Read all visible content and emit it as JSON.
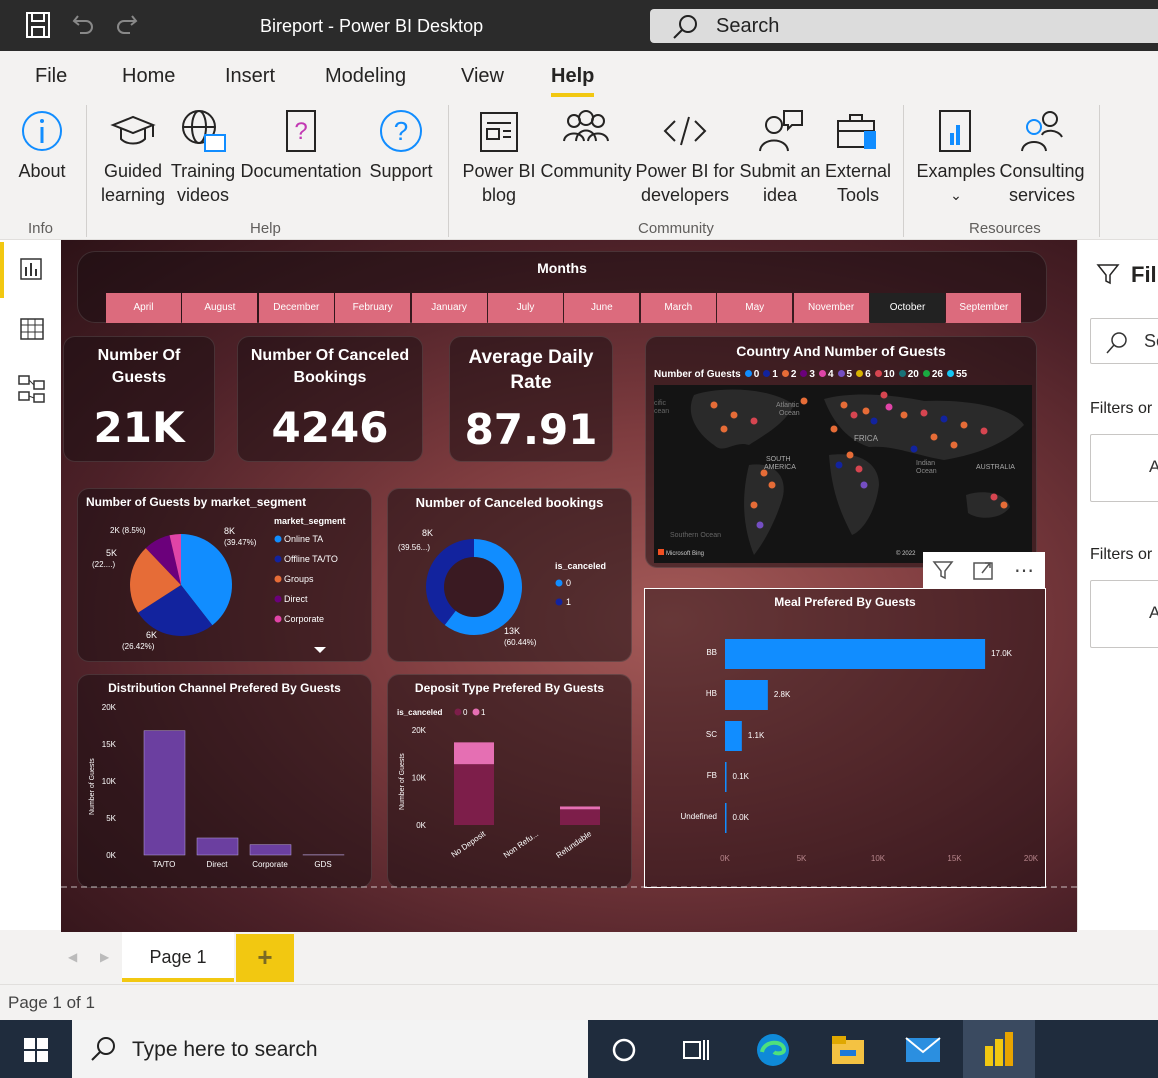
{
  "window": {
    "title": "Bireport - Power BI Desktop",
    "search_label": "Search"
  },
  "menu": [
    "File",
    "Home",
    "Insert",
    "Modeling",
    "View",
    "Help"
  ],
  "ribbon": {
    "buttons": {
      "about": "About",
      "guided": [
        "Guided",
        "learning"
      ],
      "training": [
        "Training",
        "videos"
      ],
      "documentation": "Documentation",
      "support": "Support",
      "blog": [
        "Power BI",
        "blog"
      ],
      "community": "Community",
      "developers": [
        "Power BI for",
        "developers"
      ],
      "submit": [
        "Submit an",
        "idea"
      ],
      "external": [
        "External",
        "Tools"
      ],
      "examples": "Examples",
      "consulting": [
        "Consulting",
        "services"
      ]
    },
    "groups": {
      "info": "Info",
      "help": "Help",
      "community": "Community",
      "resources": "Resources"
    }
  },
  "slicer": {
    "title": "Months",
    "items": [
      "April",
      "August",
      "December",
      "February",
      "January",
      "July",
      "June",
      "March",
      "May",
      "November",
      "October",
      "September"
    ],
    "selected": "October"
  },
  "kpis": [
    {
      "title": [
        "Number Of",
        "Guests"
      ],
      "value": "21K"
    },
    {
      "title": [
        "Number Of Canceled",
        "Bookings"
      ],
      "value": "4246"
    },
    {
      "title": [
        "Average Daily",
        "Rate"
      ],
      "value": "87.91"
    }
  ],
  "map": {
    "title": "Country And Number of Guests",
    "legend_label": "Number of Guests",
    "legend_items": [
      {
        "label": "0",
        "color": "#118dff"
      },
      {
        "label": "1",
        "color": "#12239e"
      },
      {
        "label": "2",
        "color": "#e66c37"
      },
      {
        "label": "3",
        "color": "#6b007b"
      },
      {
        "label": "4",
        "color": "#e044a7"
      },
      {
        "label": "5",
        "color": "#744ec2"
      },
      {
        "label": "6",
        "color": "#d9b300"
      },
      {
        "label": "10",
        "color": "#d64550"
      },
      {
        "label": "20",
        "color": "#197278"
      },
      {
        "label": "26",
        "color": "#1aab40"
      },
      {
        "label": "55",
        "color": "#15c6f4"
      }
    ],
    "labels": {
      "atlantic": [
        "Atlantic",
        "Ocean"
      ],
      "africa": "FRICA",
      "south_america": [
        "SOUTH",
        "AMERICA"
      ],
      "indian": [
        "Indian",
        "Ocean"
      ],
      "australia": "AUSTRALIA",
      "southern": "Southern Ocean",
      "pacific": [
        "cific",
        "cean"
      ],
      "bing": "Microsoft Bing",
      "copyright": "© 2022"
    }
  },
  "pie": {
    "title": "Number of Guests by market_segment",
    "legend_title": "market_segment",
    "labels": {
      "top": [
        "8K",
        "(39.47%)"
      ],
      "bottom": [
        "6K",
        "(26.42%)"
      ],
      "left": [
        "5K",
        "(22....)"
      ],
      "topleft": "2K (8.5%)"
    }
  },
  "donut": {
    "title": "Number of Canceled bookings",
    "legend_title": "is_canceled",
    "labels": {
      "left": [
        "8K",
        "(39.56...)"
      ],
      "right": [
        "13K",
        "(60.44%)"
      ]
    }
  },
  "dist": {
    "title": "Distribution Channel Prefered By Guests",
    "ylabel": "Number of Guests"
  },
  "deposit": {
    "title": "Deposit Type Prefered By Guests",
    "ylabel": "Number of Guests",
    "legend_title": "is_canceled"
  },
  "meal": {
    "title": "Meal Prefered By Guests"
  },
  "chart_data": [
    {
      "type": "pie",
      "title": "Number of Guests by market_segment",
      "categories": [
        "Online TA",
        "Offline TA/TO",
        "Groups",
        "Direct",
        "Corporate"
      ],
      "values": [
        39.47,
        26.42,
        22.0,
        8.5,
        3.61
      ],
      "colors": [
        "#118dff",
        "#12239e",
        "#e66c37",
        "#6b007b",
        "#e044a7"
      ]
    },
    {
      "type": "pie",
      "title": "Number of Canceled bookings",
      "categories": [
        "0",
        "1"
      ],
      "values": [
        60.44,
        39.56
      ],
      "colors": [
        "#118dff",
        "#12239e"
      ]
    },
    {
      "type": "bar",
      "title": "Distribution Channel Prefered By Guests",
      "categories": [
        "TA/TO",
        "Direct",
        "Corporate",
        "GDS"
      ],
      "values": [
        16800,
        2300,
        1400,
        30
      ],
      "ylabel": "Number of Guests",
      "ylim": [
        0,
        20000
      ],
      "yticks": [
        "0K",
        "5K",
        "10K",
        "15K",
        "20K"
      ],
      "color": "#6b3fa0"
    },
    {
      "type": "bar",
      "title": "Deposit Type Prefered By Guests",
      "categories": [
        "No Deposit",
        "Non Refu...",
        "Refundable"
      ],
      "series": [
        {
          "name": "0",
          "values": [
            12800,
            0,
            3300
          ]
        },
        {
          "name": "1",
          "values": [
            4600,
            0,
            600
          ]
        }
      ],
      "stacked": true,
      "ylabel": "Number of Guests",
      "ylim": [
        0,
        20000
      ],
      "yticks": [
        "0K",
        "10K",
        "20K"
      ],
      "colors": [
        "#7d1e4a",
        "#e56fb3"
      ]
    },
    {
      "type": "bar",
      "orientation": "horizontal",
      "title": "Meal Prefered By Guests",
      "categories": [
        "BB",
        "HB",
        "SC",
        "FB",
        "Undefined"
      ],
      "values": [
        17000,
        2800,
        1100,
        100,
        0
      ],
      "value_labels": [
        "17.0K",
        "2.8K",
        "1.1K",
        "0.1K",
        "0.0K"
      ],
      "xlim": [
        0,
        20000
      ],
      "xticks": [
        "0K",
        "5K",
        "10K",
        "15K",
        "20K"
      ],
      "color": "#118dff"
    }
  ],
  "filters": {
    "title": "Fil",
    "search": "Se",
    "filters_on_page": "Filters or",
    "filters_on_all": "Filters or",
    "add1": "A",
    "add2": "A"
  },
  "pages": {
    "page1": "Page 1",
    "add": "+"
  },
  "status": "Page 1 of 1",
  "taskbar": {
    "search": "Type here to search"
  }
}
